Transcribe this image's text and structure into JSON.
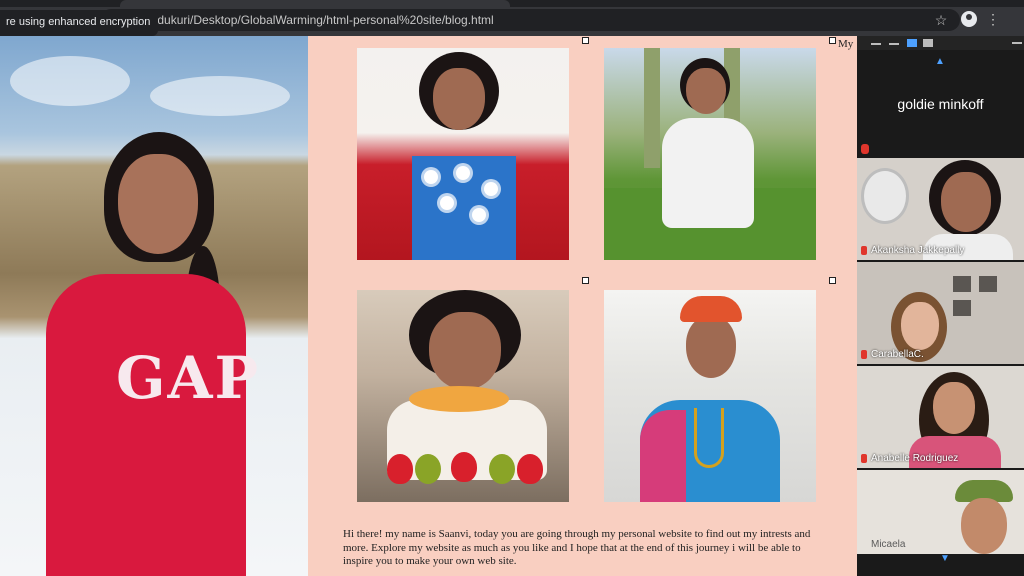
{
  "browser": {
    "url": "sers/sindukuri/Desktop/GlobalWarming/html-personal%20site/blog.html",
    "tooltip": "re using enhanced encryption"
  },
  "page": {
    "nav_partial": "My",
    "hero_shirt_text": "GAP",
    "intro_text": "Hi there! my name is Saanvi, today you are going through my personal website to find out my intrests and more. Explore my website as much as you like and I hope that at the end of this journey i will be able to inspire you to make your own web site."
  },
  "zoom": {
    "active_speaker": "goldie minkoff",
    "participants": [
      {
        "name": "Akanksha Jakkepally"
      },
      {
        "name": "CarabellaC."
      },
      {
        "name": "Anabelle Rodriguez"
      },
      {
        "name": "Micaela"
      }
    ]
  },
  "colors": {
    "page_background": "#f9cfc1",
    "zoom_background": "#1a1a1a",
    "accent_blue": "#4ea1ff",
    "mute_red": "#e0362c"
  }
}
